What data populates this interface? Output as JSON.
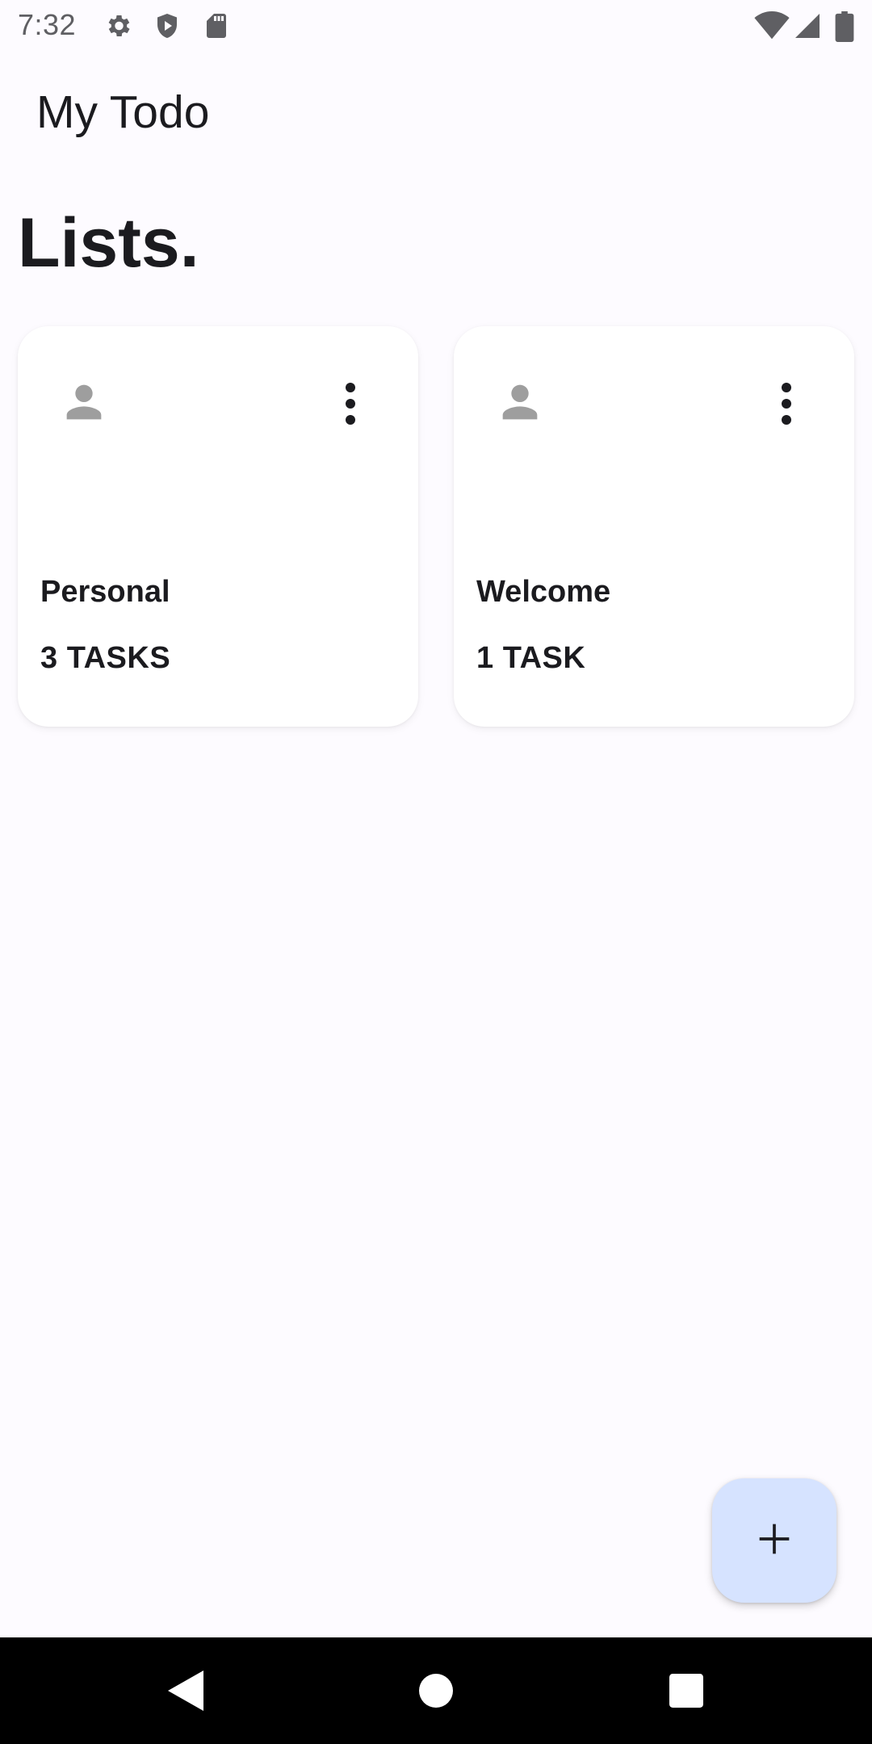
{
  "status_bar": {
    "time": "7:32",
    "icons_left": [
      "settings-icon",
      "shield-play-icon",
      "sd-card-icon"
    ],
    "icons_right": [
      "wifi-icon",
      "cell-signal-icon",
      "battery-icon"
    ]
  },
  "app_bar": {
    "title": "My Todo"
  },
  "header": {
    "title": "Lists."
  },
  "lists": [
    {
      "name": "Personal",
      "count": "3 TASKS",
      "icon": "person-icon",
      "menu_icon": "more-vert-icon"
    },
    {
      "name": "Welcome",
      "count": "1 TASK",
      "icon": "person-icon",
      "menu_icon": "more-vert-icon"
    }
  ],
  "fab": {
    "icon": "plus-icon"
  },
  "nav_bar": {
    "buttons": [
      "back-icon",
      "home-icon",
      "recents-icon"
    ]
  },
  "colors": {
    "background": "#fdfbff",
    "card": "#ffffff",
    "fab": "#d6e3ff",
    "text": "#1b1b1f",
    "icon_gray": "#9e9e9e",
    "nav_bar": "#000000"
  }
}
